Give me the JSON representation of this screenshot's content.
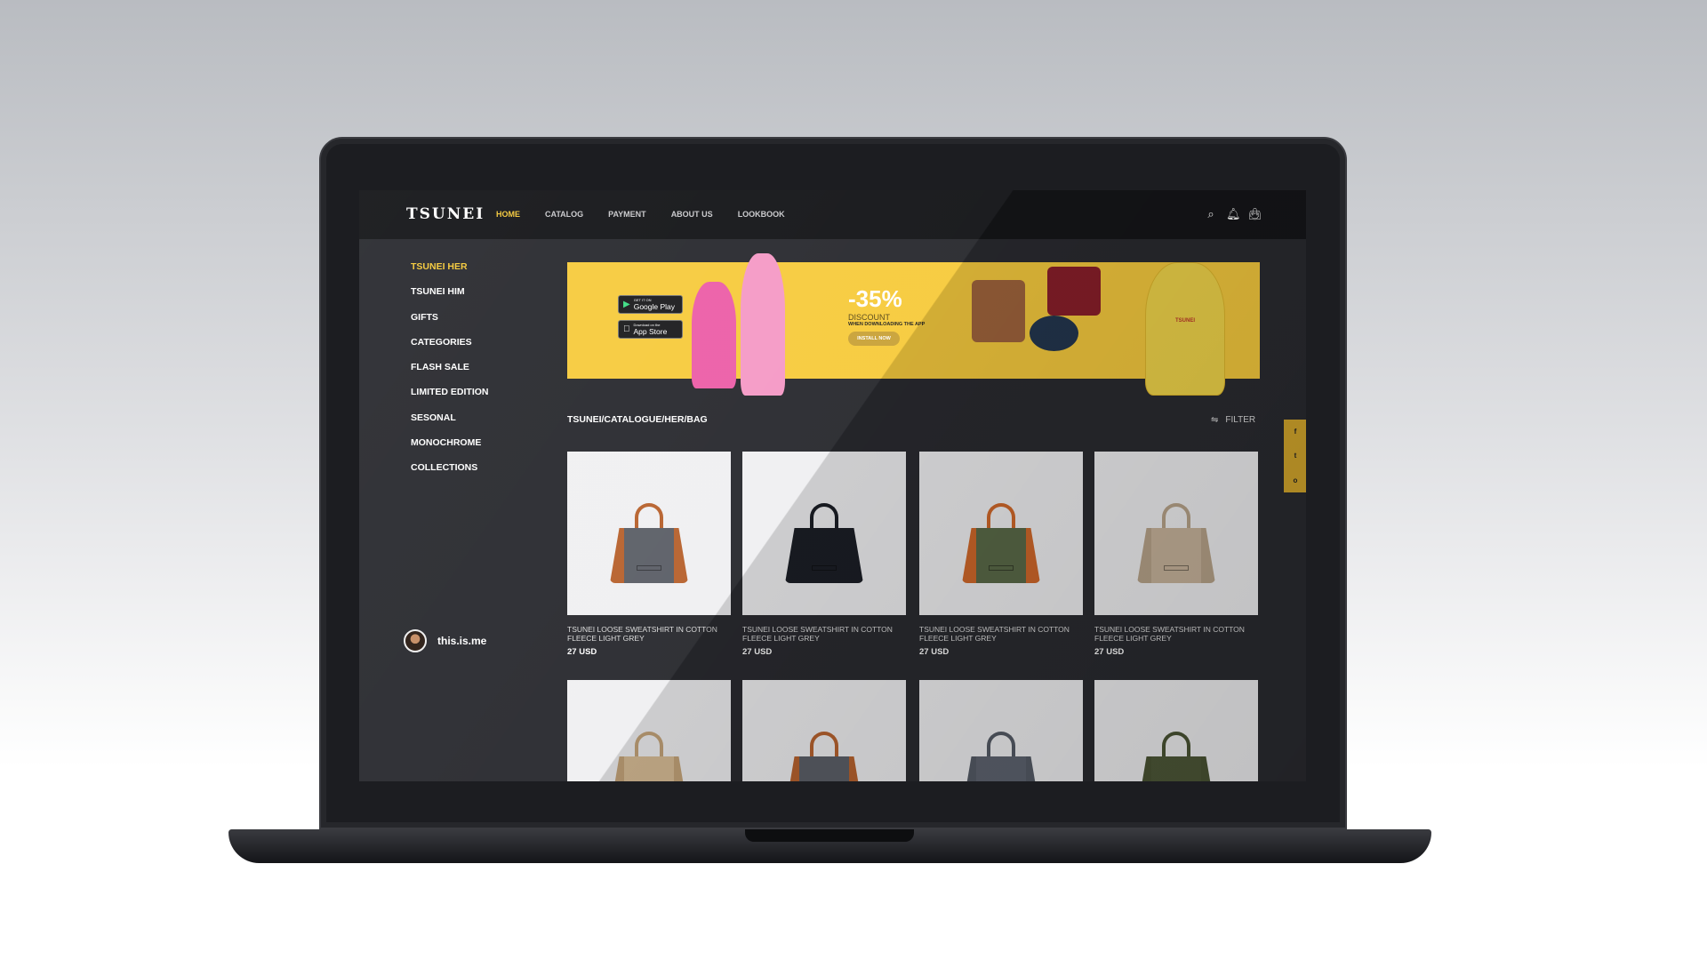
{
  "header": {
    "logo": "TSUNEI",
    "nav": [
      "HOME",
      "CATALOG",
      "PAYMENT",
      "ABOUT US",
      "LOOKBOOK"
    ],
    "active_nav": "HOME",
    "icons": [
      "search-icon",
      "bell-icon",
      "bag-icon"
    ]
  },
  "sidebar": {
    "items": [
      "TSUNEI HER",
      "TSUNEI HIM",
      "GIFTS",
      "CATEGORIES",
      "FLASH SALE",
      "LIMITED EDITION",
      "SESONAL",
      "MONOCHROME",
      "COLLECTIONS"
    ],
    "active": "TSUNEI HER"
  },
  "user": {
    "name": "this.is.me"
  },
  "banner": {
    "google_small": "GET IT ON",
    "google": "Google Play",
    "apple_small": "Download on the",
    "apple": "App Store",
    "percent": "-35%",
    "discount": "DISCOUNT",
    "sub": "WHEN DOWNLOADING THE APP",
    "install": "INSTALL NOW",
    "shirt_text": "TSUNEI",
    "bg": "#f7cb3e"
  },
  "breadcrumb": "TSUNEI/CATALOGUE/HER/BAG",
  "filter": "FILTER",
  "social": [
    "f",
    "t",
    "o"
  ],
  "products": [
    {
      "title": "TSUNEI LOOSE SWEATSHIRT IN COTTON FLEECE LIGHT GREY",
      "price": "27 USD",
      "color": "#5c6068",
      "trim": "#b8632f"
    },
    {
      "title": "TSUNEI LOOSE SWEATSHIRT IN COTTON FLEECE LIGHT GREY",
      "price": "27 USD",
      "color": "#1b1e26",
      "trim": "#1b1e26"
    },
    {
      "title": "TSUNEI LOOSE SWEATSHIRT IN COTTON FLEECE LIGHT GREY",
      "price": "27 USD",
      "color": "#5a6a48",
      "trim": "#d0682a"
    },
    {
      "title": "TSUNEI LOOSE SWEATSHIRT IN COTTON FLEECE LIGHT GREY",
      "price": "27 USD",
      "color": "#c8b49c",
      "trim": "#b8a48a"
    },
    {
      "color": "#d8bd96",
      "trim": "#c4a47a"
    },
    {
      "color": "#5c6068",
      "trim": "#b8632f"
    },
    {
      "color": "#5e6470",
      "trim": "#555b66"
    },
    {
      "color": "#4e5838",
      "trim": "#4a5434"
    }
  ]
}
